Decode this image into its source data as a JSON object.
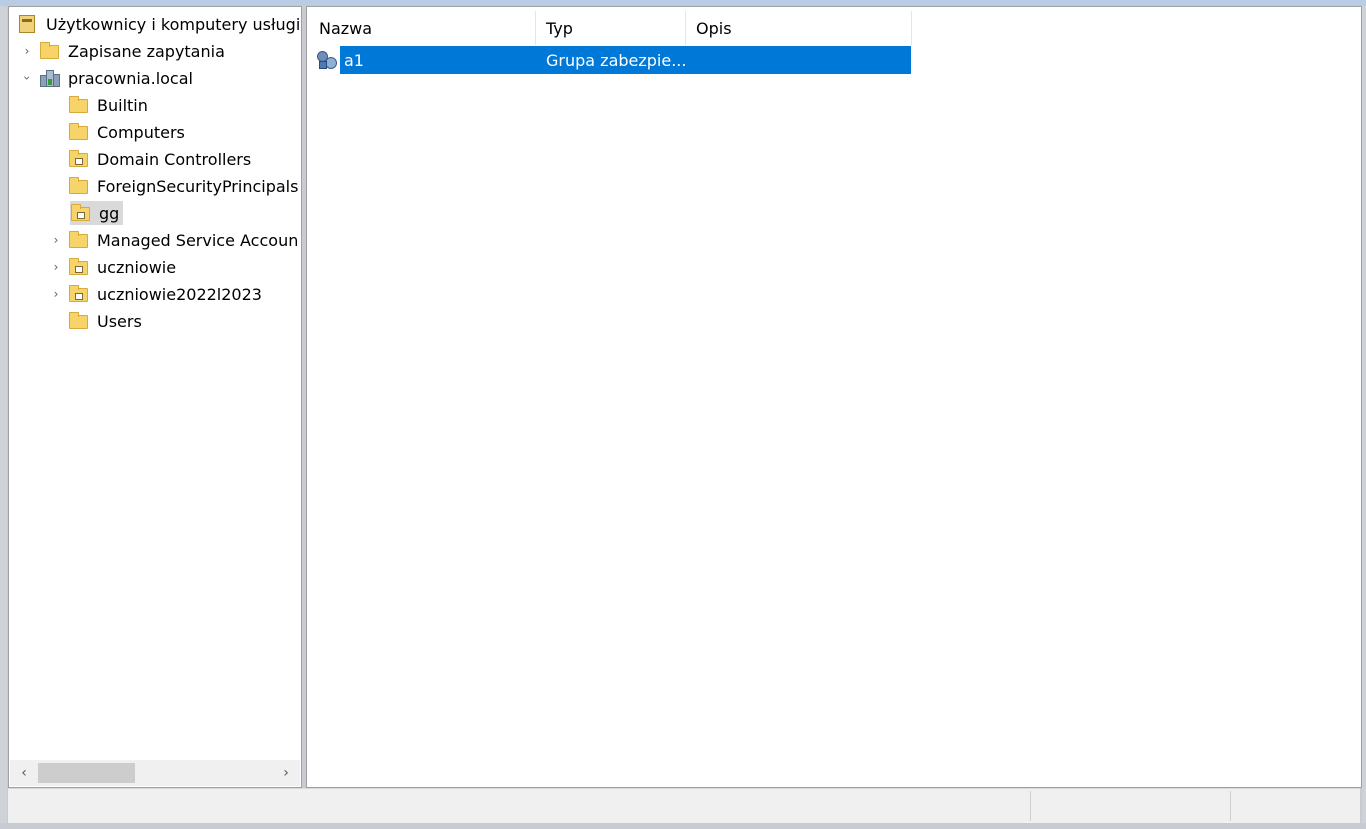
{
  "tree": {
    "root_label": "Użytkownicy i komputery usługi",
    "items": [
      {
        "label": "Zapisane zapytania",
        "icon": "folder-icon",
        "expander": "collapsed"
      },
      {
        "label": "pracownia.local",
        "icon": "domain-icon",
        "expander": "expanded"
      },
      {
        "label": "Builtin",
        "icon": "folder-icon",
        "expander": "none"
      },
      {
        "label": "Computers",
        "icon": "folder-icon",
        "expander": "none"
      },
      {
        "label": "Domain Controllers",
        "icon": "ou-folder-icon",
        "expander": "none"
      },
      {
        "label": "ForeignSecurityPrincipals",
        "icon": "folder-icon",
        "expander": "none"
      },
      {
        "label": "gg",
        "icon": "ou-folder-icon",
        "expander": "none",
        "selected": true
      },
      {
        "label": "Managed Service Accoun",
        "icon": "folder-icon",
        "expander": "collapsed"
      },
      {
        "label": "uczniowie",
        "icon": "ou-folder-icon",
        "expander": "collapsed"
      },
      {
        "label": "uczniowie2022l2023",
        "icon": "ou-folder-icon",
        "expander": "collapsed"
      },
      {
        "label": "Users",
        "icon": "folder-icon",
        "expander": "none"
      }
    ]
  },
  "list": {
    "columns": [
      "Nazwa",
      "Typ",
      "Opis"
    ],
    "rows": [
      {
        "name": "a1",
        "type": "Grupa zabezpie...",
        "description": "",
        "icon": "security-group-icon",
        "selected": true
      }
    ]
  },
  "colors": {
    "selection": "#0078d7",
    "tree_selection": "#d9d9d9",
    "folder": "#f6d469"
  }
}
